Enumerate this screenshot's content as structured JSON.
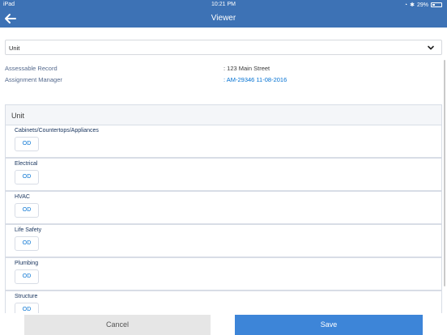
{
  "status_bar": {
    "carrier": "iPad",
    "time": "10:21 PM",
    "battery": "29%"
  },
  "nav": {
    "title": "Viewer",
    "back_icon": "back-arrow-icon"
  },
  "selector": {
    "value": "Unit",
    "icon": "chevron-down-icon"
  },
  "info": {
    "assessable_label": "Assessable Record",
    "assessable_value": ": 123 Main Street",
    "manager_label": "Assignment Manager",
    "manager_value": ": AM-29346 11-08-2016"
  },
  "section": {
    "title": "Unit",
    "rows": [
      {
        "label": "Cabinets/Countertops/Appliances",
        "button": "OD"
      },
      {
        "label": "Electrical",
        "button": "OD"
      },
      {
        "label": "HVAC",
        "button": "OD"
      },
      {
        "label": "Life Safety",
        "button": "OD"
      },
      {
        "label": "Plumbing",
        "button": "OD"
      },
      {
        "label": "Structure",
        "button": "OD"
      }
    ]
  },
  "footer": {
    "cancel_label": "Cancel",
    "save_label": "Save"
  },
  "colors": {
    "header_bg": "#3d72b5",
    "save_bg": "#3d85d8",
    "link": "#0070d2"
  }
}
